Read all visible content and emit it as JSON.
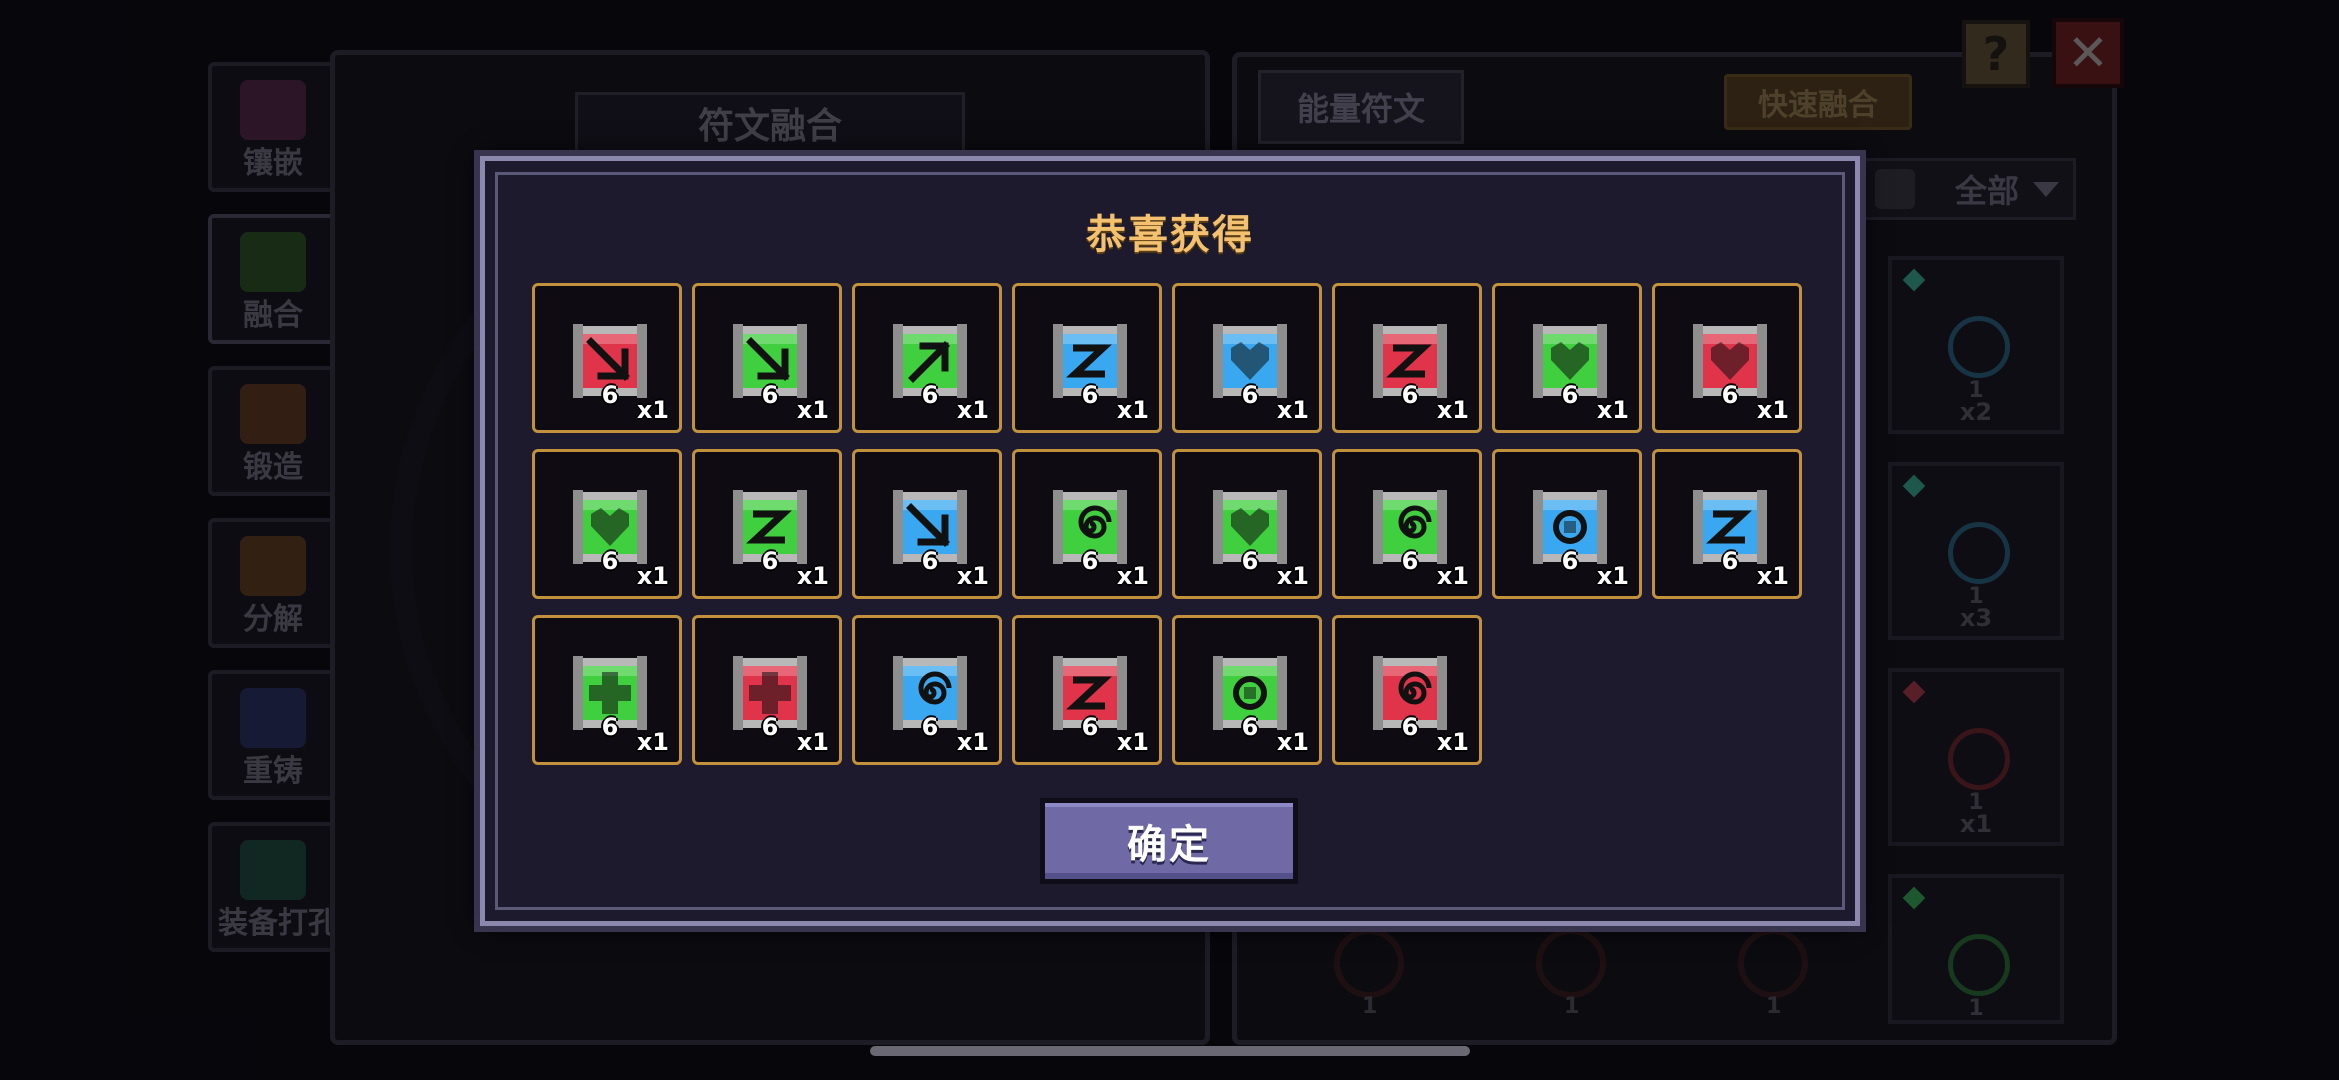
{
  "side_nav": [
    {
      "label": "镶嵌",
      "color": "#8a3a6a"
    },
    {
      "label": "融合",
      "color": "#3f8a2a"
    },
    {
      "label": "锻造",
      "color": "#a05a20"
    },
    {
      "label": "分解",
      "color": "#a06020"
    },
    {
      "label": "重铸",
      "color": "#3a4aa0"
    },
    {
      "label": "装备打孔",
      "color": "#2a7a5a"
    }
  ],
  "fusion_panel": {
    "title": "符文融合"
  },
  "rune_panel": {
    "tab_label": "能量符文",
    "quick_fuse_label": "快速融合",
    "filter_label": "全部",
    "slots": [
      {
        "level": "1",
        "count": "x2",
        "gem_color": "#3fbf9f",
        "orb_color": "#2f6f8f"
      },
      {
        "level": "1",
        "count": "x3",
        "gem_color": "#3fbf9f",
        "orb_color": "#2f6f8f"
      },
      {
        "level": "1",
        "count": "x1",
        "gem_color": "#c04050",
        "orb_color": "#7a2a30"
      },
      {
        "level": "1",
        "count": "",
        "gem_color": "#3fbf5f",
        "orb_color": "#2f7a3a"
      }
    ],
    "bottom_levels": [
      "1",
      "1",
      "1"
    ]
  },
  "buttons": {
    "help": "?",
    "close": "✕"
  },
  "modal": {
    "title": "恭喜获得",
    "confirm_label": "确定",
    "rewards": [
      {
        "level": "6",
        "qty": "x1",
        "color": "#e0344a",
        "icon": "arrow-down-right-rune-icon"
      },
      {
        "level": "6",
        "qty": "x1",
        "color": "#3fcf3f",
        "icon": "arrow-down-right-rune-icon"
      },
      {
        "level": "6",
        "qty": "x1",
        "color": "#3fcf3f",
        "icon": "arrow-up-right-rune-icon"
      },
      {
        "level": "6",
        "qty": "x1",
        "color": "#3aa8f0",
        "icon": "zigzag-rune-icon"
      },
      {
        "level": "6",
        "qty": "x1",
        "color": "#3aa8f0",
        "icon": "heart-rune-icon"
      },
      {
        "level": "6",
        "qty": "x1",
        "color": "#e0344a",
        "icon": "zigzag-rune-icon"
      },
      {
        "level": "6",
        "qty": "x1",
        "color": "#3fcf3f",
        "icon": "heart-rune-icon"
      },
      {
        "level": "6",
        "qty": "x1",
        "color": "#e0344a",
        "icon": "heart-rune-icon"
      },
      {
        "level": "6",
        "qty": "x1",
        "color": "#3fcf3f",
        "icon": "heart-rune-icon"
      },
      {
        "level": "6",
        "qty": "x1",
        "color": "#3fcf3f",
        "icon": "zigzag-rune-icon"
      },
      {
        "level": "6",
        "qty": "x1",
        "color": "#3aa8f0",
        "icon": "arrow-down-right-rune-icon"
      },
      {
        "level": "6",
        "qty": "x1",
        "color": "#3fcf3f",
        "icon": "spiral-rune-icon"
      },
      {
        "level": "6",
        "qty": "x1",
        "color": "#3fcf3f",
        "icon": "heart-rune-icon"
      },
      {
        "level": "6",
        "qty": "x1",
        "color": "#3fcf3f",
        "icon": "spiral-rune-icon"
      },
      {
        "level": "6",
        "qty": "x1",
        "color": "#3aa8f0",
        "icon": "circle-rune-icon"
      },
      {
        "level": "6",
        "qty": "x1",
        "color": "#3aa8f0",
        "icon": "zigzag-rune-icon"
      },
      {
        "level": "6",
        "qty": "x1",
        "color": "#3fcf3f",
        "icon": "cross-rune-icon"
      },
      {
        "level": "6",
        "qty": "x1",
        "color": "#e0344a",
        "icon": "cross-rune-icon"
      },
      {
        "level": "6",
        "qty": "x1",
        "color": "#3aa8f0",
        "icon": "spiral-rune-icon"
      },
      {
        "level": "6",
        "qty": "x1",
        "color": "#e0344a",
        "icon": "zigzag-rune-icon"
      },
      {
        "level": "6",
        "qty": "x1",
        "color": "#3fcf3f",
        "icon": "circle-rune-icon"
      },
      {
        "level": "6",
        "qty": "x1",
        "color": "#e0344a",
        "icon": "spiral-rune-icon"
      }
    ]
  }
}
